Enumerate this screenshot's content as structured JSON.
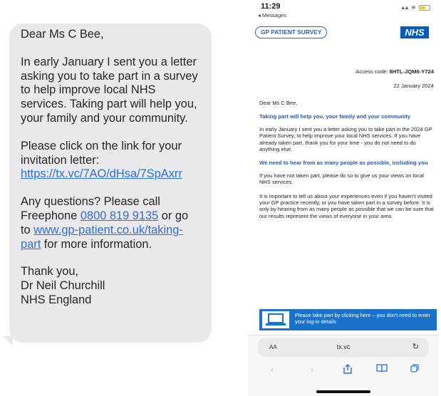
{
  "sms": {
    "greeting": "Dear Ms C Bee,",
    "para1": "In early January I sent you a letter asking you to take part in a survey to help improve local NHS services. Taking part will help you, your family and your community.",
    "para2_text": "Please click on the link for your invitation letter: ",
    "para2_link": "https://tx.vc/7AO/dHsa/7SpAxrr",
    "para3_text_a": "Any questions? Please call Freephone ",
    "para3_phone": "0800 819 9135",
    "para3_text_b": " or go to ",
    "para3_link": "www.gp-patient.co.uk/taking-part",
    "para3_text_c": " for more information.",
    "signoff": [
      "Thank you,",
      "Dr Neil Churchill",
      "NHS England"
    ]
  },
  "phone": {
    "time": "11:29",
    "back_label": "◂ Messages",
    "status_icons": "▴▴ ≋",
    "gp_logo": "GP PATIENT SURVEY",
    "nhs_logo": "NHS",
    "access_label": "Access code: ",
    "access_code": "8HTL-JQM6-Y724",
    "date": "22 January 2024",
    "greeting": "Dear Ms C Bee,",
    "heading1": "Taking part will help you, your family and your community",
    "para1": "In early January I sent you a letter asking you to take part in the 2024 GP Patient Survey, to help improve your local NHS services. If you have already taken part, thank you for your time - you do not need to do anything else.",
    "heading2": "We need to hear from as many people as possible, including you",
    "para2": "If you have not taken part, please do so to give us your views on local NHS services.",
    "para3": "It is important to tell us about your experiences even if you haven't visited your GP practice recently, or you have taken part in a survey before. It is only by hearing from as many people as possible that we can be sure that our results represent the views of everyone in your area.",
    "banner_text": "Please take part by clicking here – you don't need to enter your log-in details",
    "aa_label": "AA",
    "url": "tx.vc",
    "reload_icon": "↻",
    "nav_icons": {
      "back": "‹",
      "forward": "›",
      "share": "⇪",
      "bookmarks": "📖",
      "tabs": "⧉"
    }
  },
  "colors": {
    "link": "#2c6fd6",
    "nhs_blue": "#005eb8",
    "banner": "#1a73c9",
    "heading": "#1f5bb5",
    "bubble": "#e9e9eb"
  }
}
